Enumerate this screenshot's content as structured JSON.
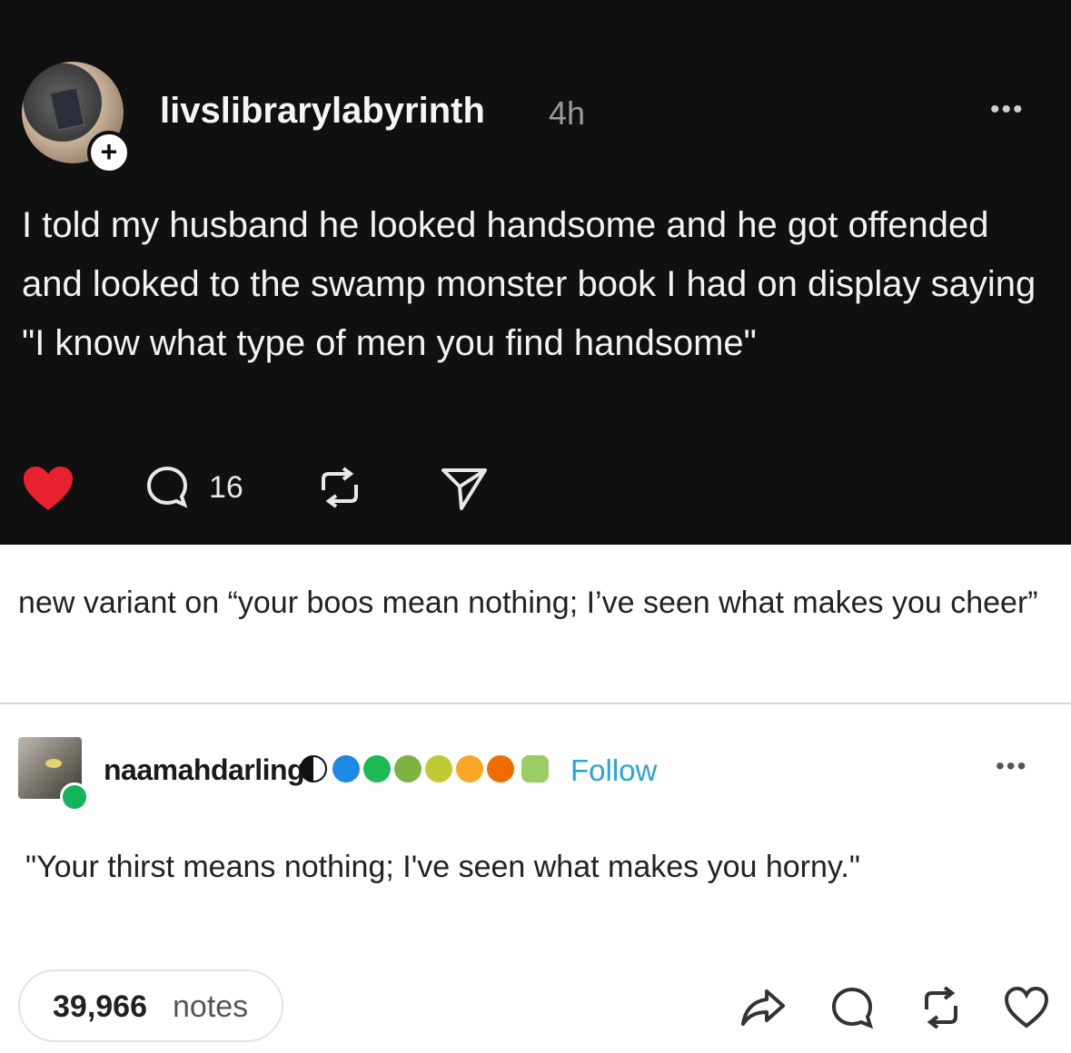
{
  "post": {
    "username": "livslibrarylabyrinth",
    "time": "4h",
    "more": "•••",
    "follow_icon": "plus-icon",
    "text": "I told my husband he looked handsome and he got offended and looked to the swamp monster book I had on display saying \"I know what type of men you find handsome\"",
    "comment_count": "16",
    "colors": {
      "background": "#101010",
      "like": "#e8212f"
    },
    "icons": [
      "heart-filled-icon",
      "comment-icon",
      "reblog-icon",
      "share-icon"
    ]
  },
  "comment": {
    "text": "new variant on “your boos mean nothing; I’ve seen what makes you cheer”"
  },
  "reply": {
    "username": "naamahdarling",
    "follow_label": "Follow",
    "more": "•••",
    "text": "\"Your thirst means nothing; I've seen what makes you horny.\"",
    "badge_colors": [
      "#111111",
      "#1e88e5",
      "#1db954",
      "#7cb342",
      "#c0ca33",
      "#f9a825",
      "#ef6c00",
      "#9ccc65"
    ],
    "follow_color": "#2aa3d6"
  },
  "footer": {
    "notes_count": "39,966",
    "notes_label": "notes",
    "icons": [
      "share-icon",
      "comment-icon",
      "reblog-icon",
      "heart-outline-icon"
    ]
  }
}
